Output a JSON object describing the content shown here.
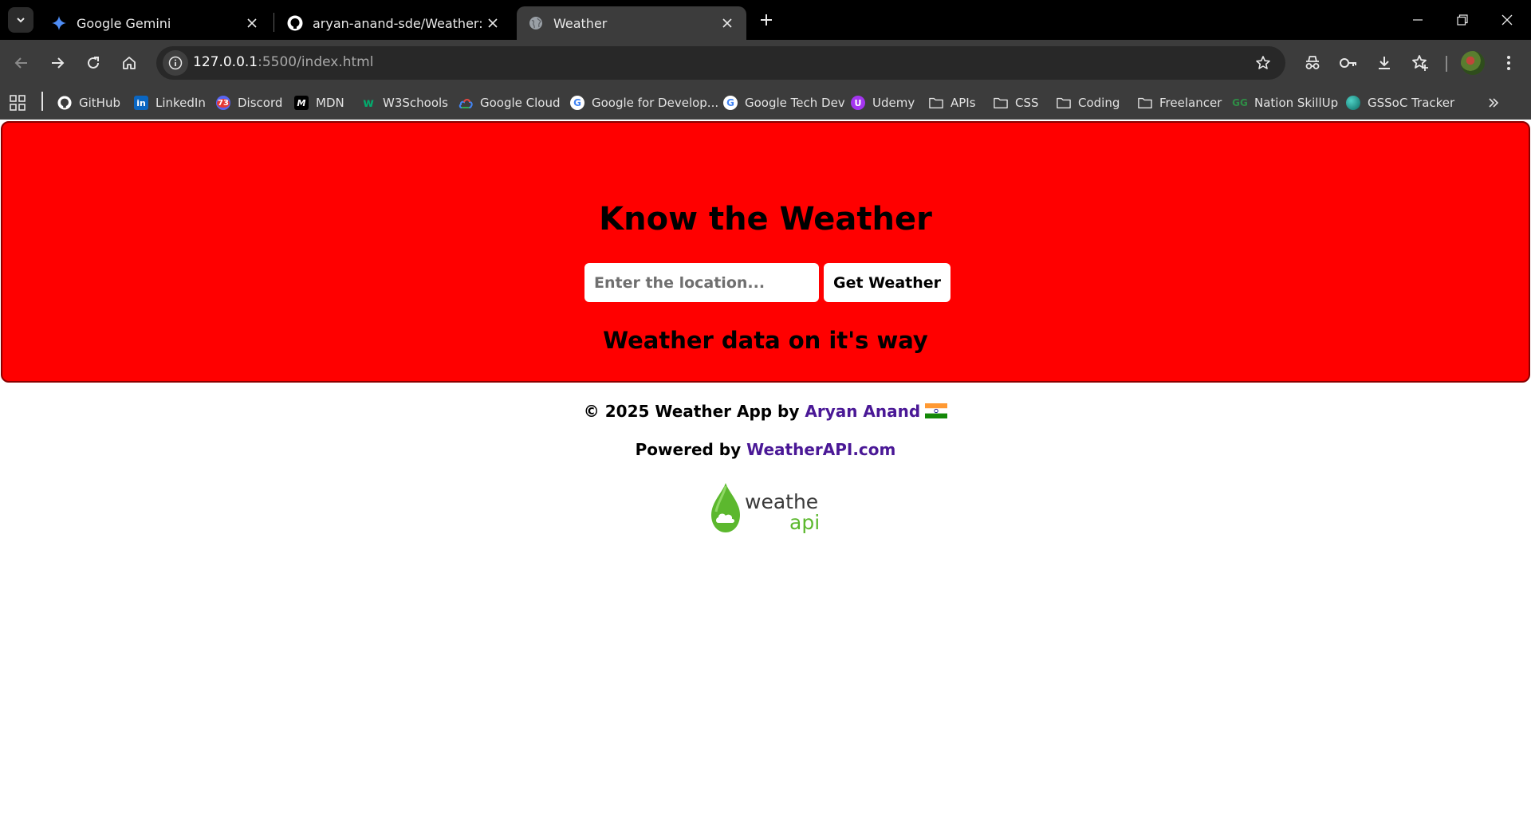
{
  "browser": {
    "tabs": [
      {
        "title": "Google Gemini",
        "favicon": "gemini-icon"
      },
      {
        "title": "aryan-anand-sde/Weather: This",
        "favicon": "github-icon"
      },
      {
        "title": "Weather",
        "favicon": "globe-icon"
      }
    ],
    "active_tab_index": 2,
    "url_host": "127.0.0.1",
    "url_path": ":5500/index.html"
  },
  "bookmarks": [
    {
      "label": "GitHub",
      "icon": "github-icon"
    },
    {
      "label": "LinkedIn",
      "icon": "linkedin-icon"
    },
    {
      "label": "Discord",
      "icon": "discord-icon",
      "badge": "73"
    },
    {
      "label": "MDN",
      "icon": "mdn-icon"
    },
    {
      "label": "W3Schools",
      "icon": "w3schools-icon"
    },
    {
      "label": "Google Cloud",
      "icon": "google-cloud-icon"
    },
    {
      "label": "Google for Develop...",
      "icon": "google-icon"
    },
    {
      "label": "Google Tech Dev",
      "icon": "google-icon"
    },
    {
      "label": "Udemy",
      "icon": "udemy-icon"
    },
    {
      "label": "APIs",
      "icon": "folder-icon"
    },
    {
      "label": "CSS",
      "icon": "folder-icon"
    },
    {
      "label": "Coding",
      "icon": "folder-icon"
    },
    {
      "label": "Freelancer",
      "icon": "folder-icon"
    },
    {
      "label": "Nation SkillUp",
      "icon": "geeksforgeeks-icon"
    },
    {
      "label": "GSSoC Tracker",
      "icon": "globe-icon"
    }
  ],
  "page": {
    "heading": "Know the Weather",
    "search_placeholder": "Enter the location...",
    "button_label": "Get Weather",
    "status": "Weather data on it's way",
    "footer_prefix": "© 2025 Weather App by ",
    "author": "Aryan Anand",
    "powered_prefix": "Powered by ",
    "powered_link": "WeatherAPI.com",
    "logo_word_1": "weather",
    "logo_word_2": "api"
  },
  "colors": {
    "card_bg": "#ff0000",
    "link": "#4a1896",
    "chrome_dark": "#000000",
    "toolbar": "#3c3c3c"
  }
}
